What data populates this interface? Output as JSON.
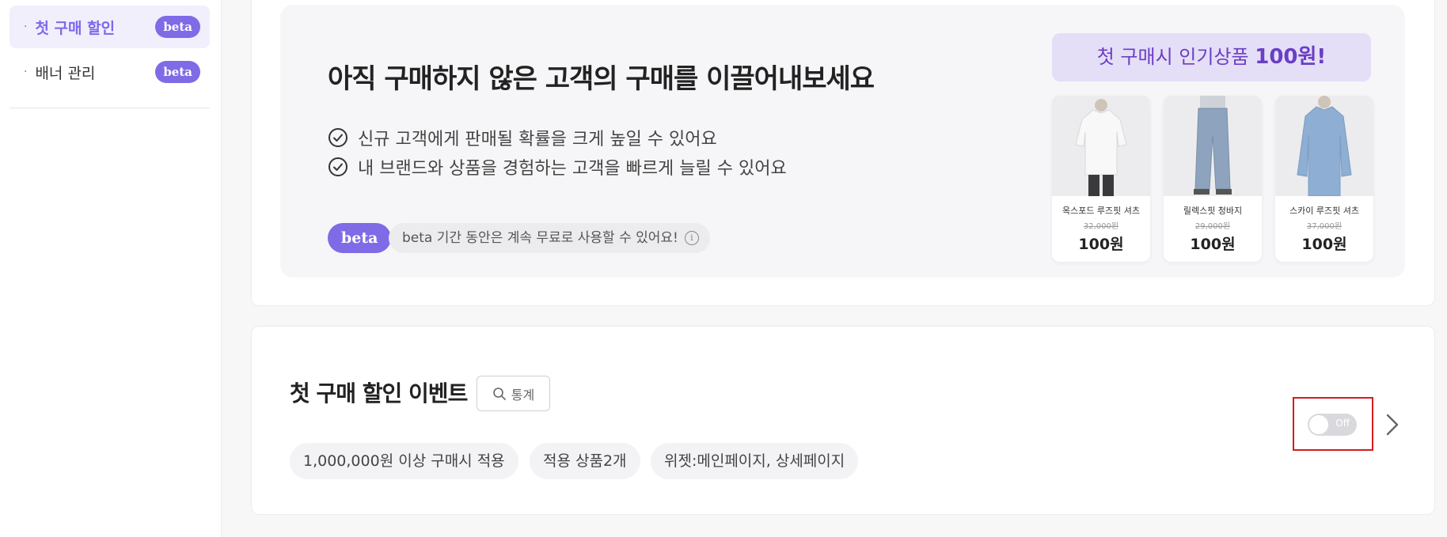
{
  "sidebar": {
    "items": [
      {
        "label": "첫 구매 할인",
        "badge": "beta",
        "active": true
      },
      {
        "label": "배너 관리",
        "badge": "beta",
        "active": false
      }
    ]
  },
  "promo": {
    "title": "아직 구매하지 않은 고객의 구매를 이끌어내보세요",
    "benefits": [
      "신규 고객에게 판매될 확률을 크게 높일 수 있어요",
      "내 브랜드와 상품을 경험하는 고객을 빠르게 늘릴 수 있어요"
    ],
    "beta_badge": "beta",
    "beta_note": "beta 기간 동안은 계속 무료로 사용할 수 있어요!",
    "info_glyph": "i",
    "headline_prefix": "첫 구매시 인기상품 ",
    "headline_emph": "100원!",
    "products": [
      {
        "name": "옥스포드 루즈핏 셔츠",
        "old_price": "32,000원",
        "price": "100원",
        "image": "white-shirt"
      },
      {
        "name": "릴렉스핏 청바지",
        "old_price": "29,000원",
        "price": "100원",
        "image": "jeans"
      },
      {
        "name": "스카이 루즈핏 셔츠",
        "old_price": "37,000원",
        "price": "100원",
        "image": "blue-shirt"
      }
    ]
  },
  "event": {
    "title": "첫 구매 할인 이벤트",
    "stats_label": "통계",
    "chips": [
      "1,000,000원 이상 구매시 적용",
      "적용 상품2개",
      "위젯:메인페이지, 상세페이지"
    ],
    "toggle_label": "Off",
    "toggle_on": false
  },
  "colors": {
    "accent": "#7f6be6",
    "highlight_border": "#d61b1b",
    "headline_bg": "#e5def7",
    "headline_text": "#6a3fc4"
  }
}
